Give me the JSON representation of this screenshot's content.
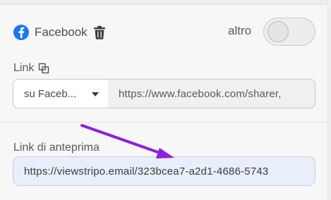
{
  "social": {
    "label": "Facebook",
    "icon": "facebook-icon",
    "delete_icon": "trash-icon",
    "brand_color": "#1877f2"
  },
  "toggle": {
    "label": "altro",
    "state": "off"
  },
  "link": {
    "label": "Link",
    "copy_icon": "copy-icon",
    "select_value": "su Faceb...",
    "url_value": "https://www.facebook.com/sharer,"
  },
  "preview": {
    "label": "Link di anteprima",
    "value": "https://viewstripo.email/323bcea7-a2d1-4686-5743"
  },
  "annotation": {
    "arrow_color": "#8b1fe0"
  }
}
